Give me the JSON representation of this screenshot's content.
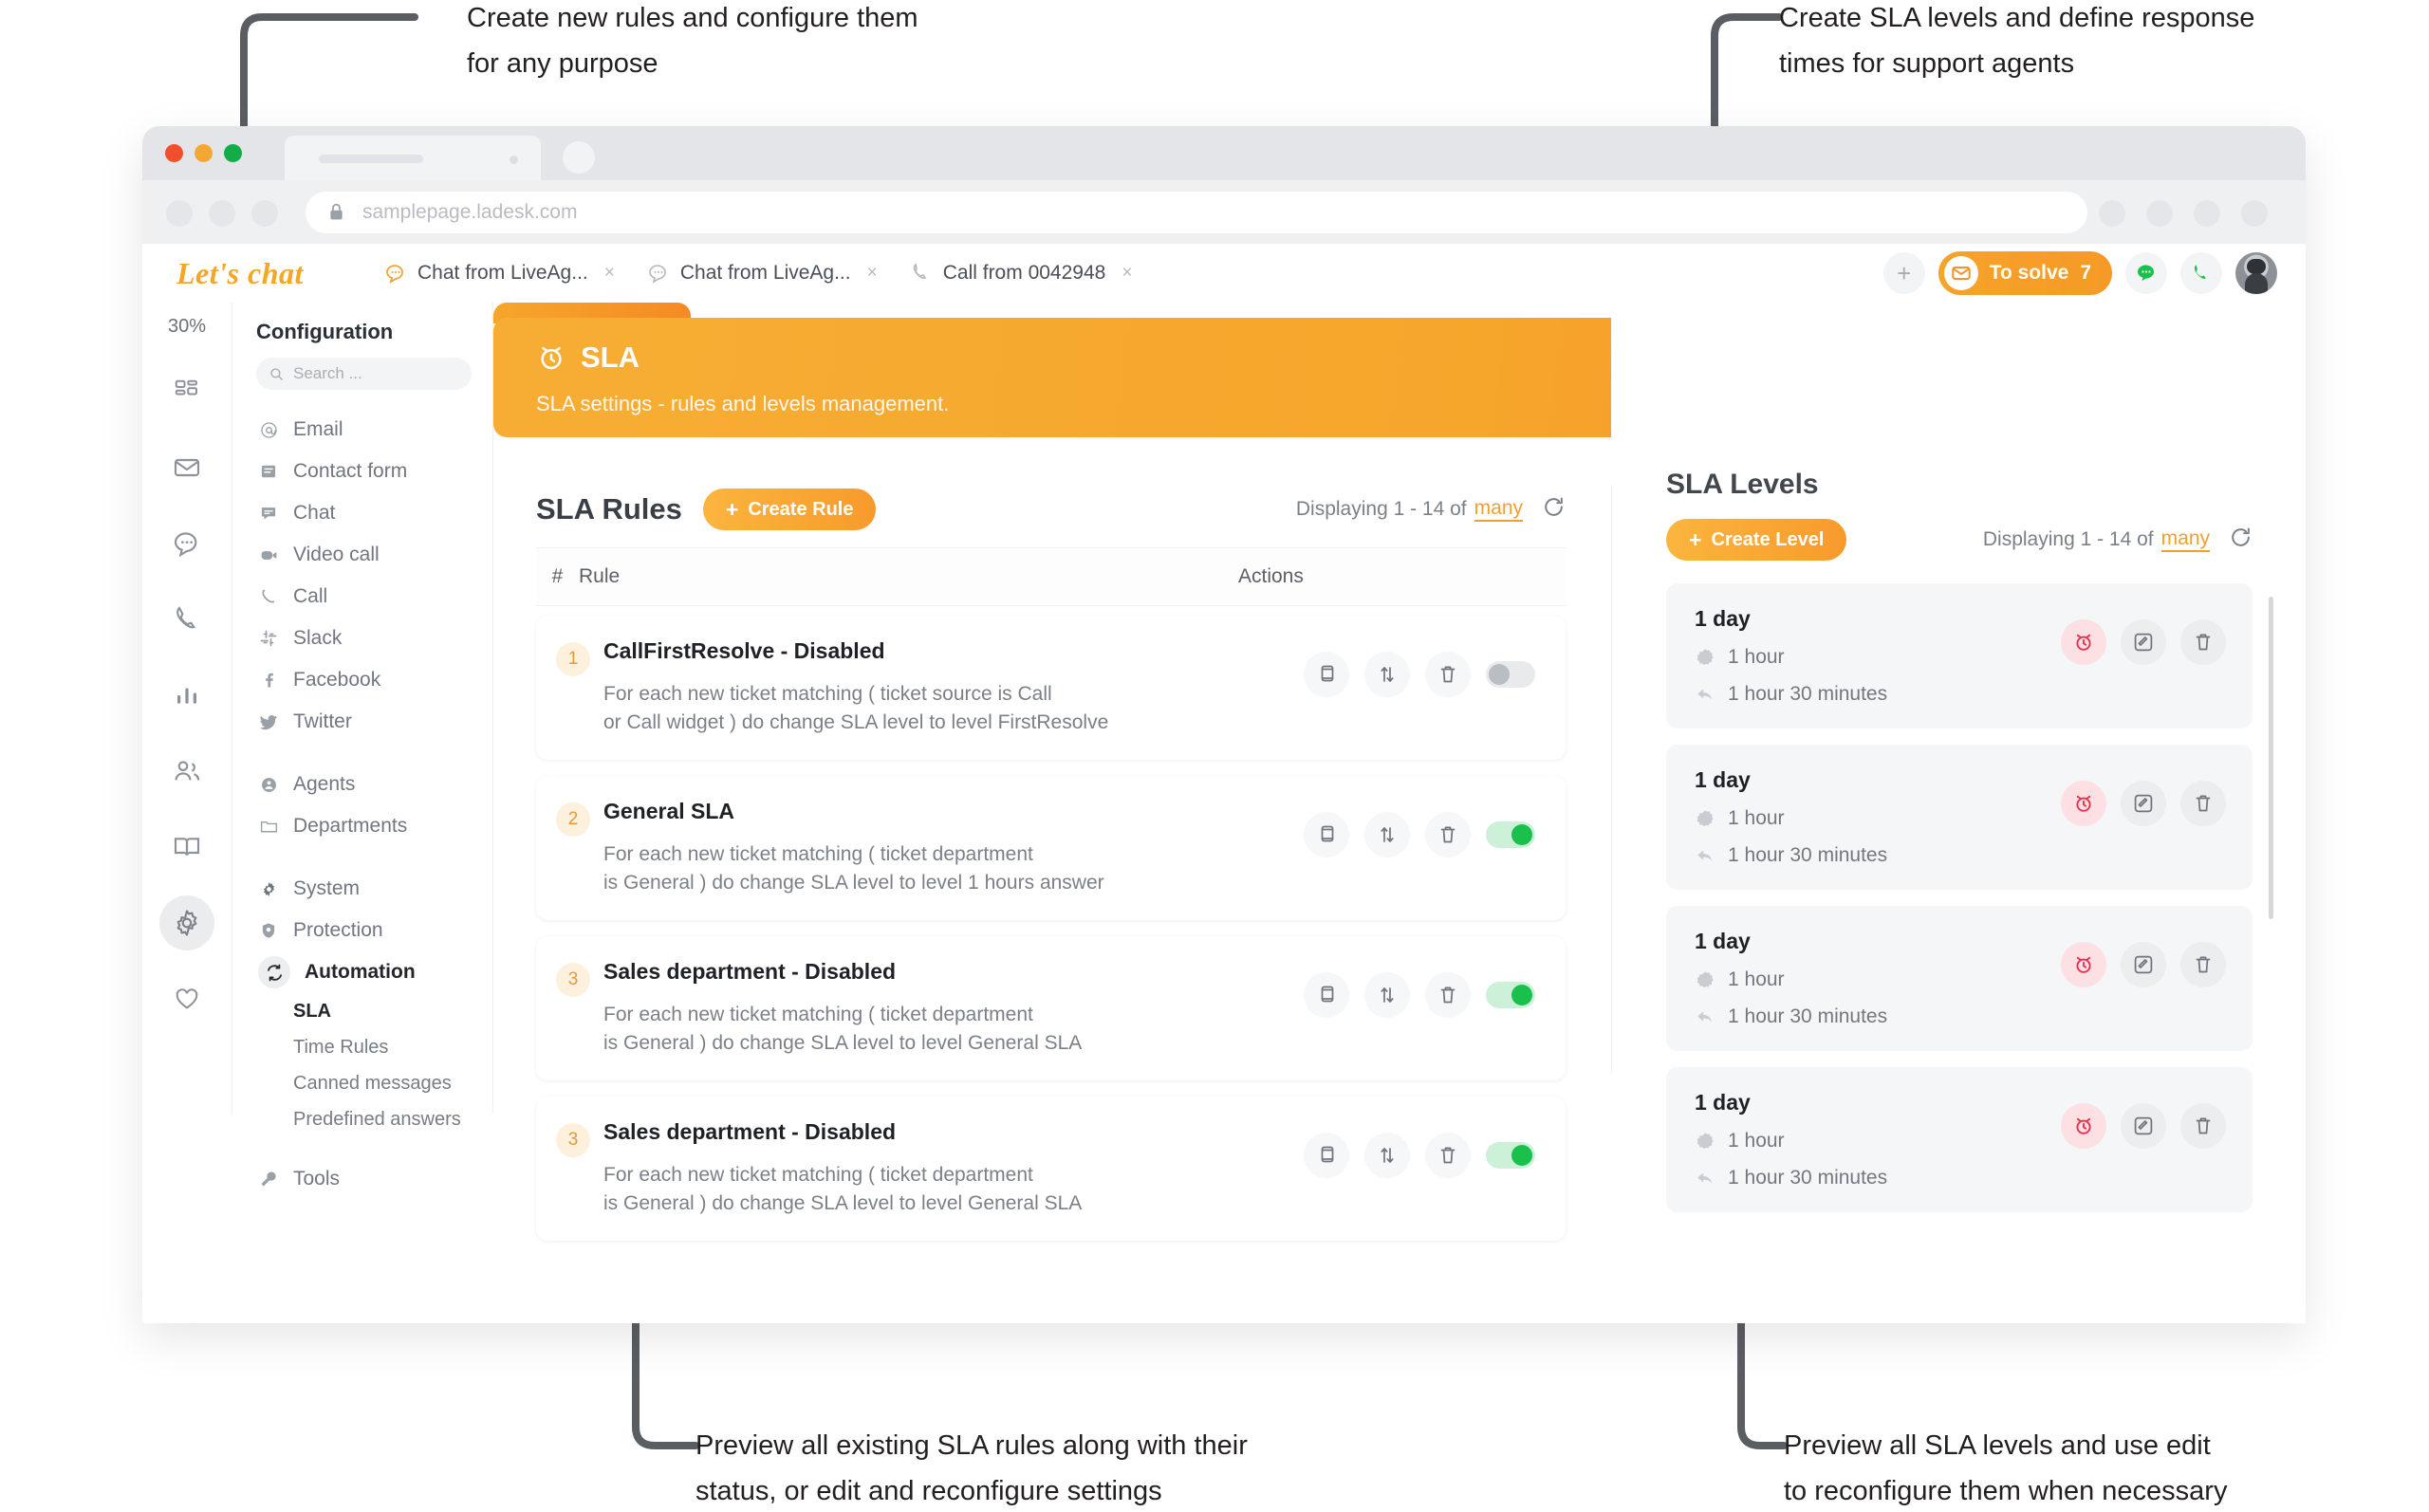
{
  "annotations": {
    "top_left": "Create new rules and configure them\nfor any purpose",
    "top_right": "Create SLA levels and define response\ntimes for support agents",
    "bottom_left": "Preview all existing SLA rules along with their\nstatus, or edit and reconfigure settings",
    "bottom_right": "Preview all SLA levels and use edit\nto reconfigure them when necessary"
  },
  "browser": {
    "url": "samplepage.ladesk.com",
    "lock_icon": "lock-icon"
  },
  "app_header": {
    "logo": "Let's chat",
    "tabs": [
      {
        "icon": "chat-icon",
        "label": "Chat from LiveAg...",
        "close": "×"
      },
      {
        "icon": "chat-icon",
        "label": "Chat from LiveAg...",
        "close": "×"
      },
      {
        "icon": "phone-icon",
        "label": "Call from 0042948",
        "close": "×"
      }
    ],
    "plus_label": "+",
    "to_solve_label": "To solve",
    "to_solve_count": "7",
    "chat_icon": "chat-bubble-icon",
    "call_icon": "phone-icon",
    "avatar": "avatar"
  },
  "rail": {
    "percent": "30%",
    "items": [
      {
        "icon": "dashboard-icon",
        "name": "dashboard"
      },
      {
        "icon": "mail-icon",
        "name": "tickets"
      },
      {
        "icon": "chat-icon",
        "name": "chats"
      },
      {
        "icon": "phone-icon",
        "name": "calls"
      },
      {
        "icon": "chart-icon",
        "name": "reports"
      },
      {
        "icon": "contacts-icon",
        "name": "customers"
      },
      {
        "icon": "book-icon",
        "name": "knowledge-base"
      },
      {
        "icon": "gear-icon",
        "name": "configuration",
        "active": true
      },
      {
        "icon": "heart-icon",
        "name": "favorites"
      }
    ]
  },
  "config_nav": {
    "title": "Configuration",
    "search_placeholder": "Search ...",
    "group1": [
      {
        "icon": "at-icon",
        "label": "Email"
      },
      {
        "icon": "form-icon",
        "label": "Contact form"
      },
      {
        "icon": "chat-icon",
        "label": "Chat"
      },
      {
        "icon": "video-icon",
        "label": "Video call"
      },
      {
        "icon": "phone-icon",
        "label": "Call"
      },
      {
        "icon": "slack-icon",
        "label": "Slack"
      },
      {
        "icon": "facebook-icon",
        "label": "Facebook"
      },
      {
        "icon": "twitter-icon",
        "label": "Twitter"
      }
    ],
    "group2": [
      {
        "icon": "agents-icon",
        "label": "Agents"
      },
      {
        "icon": "folder-icon",
        "label": "Departments"
      }
    ],
    "group3": [
      {
        "icon": "gear-icon",
        "label": "System"
      },
      {
        "icon": "shield-icon",
        "label": "Protection"
      },
      {
        "icon": "automation-icon",
        "label": "Automation",
        "bold": true
      }
    ],
    "sub_items": [
      {
        "label": "SLA",
        "selected": true
      },
      {
        "label": "Time Rules",
        "selected": false
      },
      {
        "label": "Canned messages",
        "selected": false
      },
      {
        "label": "Predefined answers",
        "selected": false
      }
    ],
    "group4": [
      {
        "icon": "tools-icon",
        "label": "Tools"
      }
    ]
  },
  "banner": {
    "icon": "alarm-clock-icon",
    "title": "SLA",
    "subtitle": "SLA settings - rules and levels management."
  },
  "rules_panel": {
    "heading": "SLA Rules",
    "create_button": "Create Rule",
    "create_button_icon": "plus-icon",
    "displaying_prefix": "Displaying 1 - 14 of",
    "displaying_many": "many",
    "refresh_icon": "refresh-icon",
    "columns": {
      "hash": "#",
      "rule": "Rule",
      "actions": "Actions"
    },
    "rows": [
      {
        "num": "1",
        "title": "CallFirstResolve - Disabled",
        "desc": "For each new ticket matching ( ticket source is Call\nor Call widget ) do change SLA level to level FirstResolve",
        "enabled": false
      },
      {
        "num": "2",
        "title": "General SLA",
        "desc": "For each new ticket matching ( ticket department\nis General ) do change SLA level to level 1 hours answer",
        "enabled": true
      },
      {
        "num": "3",
        "title": "Sales department - Disabled",
        "desc": "For each new ticket matching ( ticket department\nis General ) do change SLA level to level General SLA",
        "enabled": true
      },
      {
        "num": "3",
        "title": "Sales department - Disabled",
        "desc": "For each new ticket matching ( ticket department\nis General ) do change SLA level to level General SLA",
        "enabled": true
      }
    ],
    "action_icons": [
      "copy-icon",
      "sort-icon",
      "trash-icon",
      "toggle-switch"
    ]
  },
  "levels_panel": {
    "heading": "SLA Levels",
    "create_button": "Create Level",
    "create_button_icon": "plus-icon",
    "displaying_prefix": "Displaying 1 - 14 of",
    "displaying_many": "many",
    "refresh_icon": "refresh-icon",
    "cards": [
      {
        "title": "1 day",
        "response": "1 hour",
        "resolution": "1 hour 30 minutes"
      },
      {
        "title": "1 day",
        "response": "1 hour",
        "resolution": "1 hour 30 minutes"
      },
      {
        "title": "1 day",
        "response": "1 hour",
        "resolution": "1 hour 30 minutes"
      },
      {
        "title": "1 day",
        "response": "1 hour",
        "resolution": "1 hour 30 minutes"
      }
    ],
    "action_icons": [
      "alarm-clock-icon",
      "edit-icon",
      "trash-icon"
    ]
  },
  "colors": {
    "accent_orange": "#f6a62b",
    "accent_orange_dark": "#f2882a",
    "toggle_on": "#19c14c",
    "alarm_red": "#e8314e",
    "text_dark": "#1e2126",
    "text_muted": "#7b8088"
  }
}
